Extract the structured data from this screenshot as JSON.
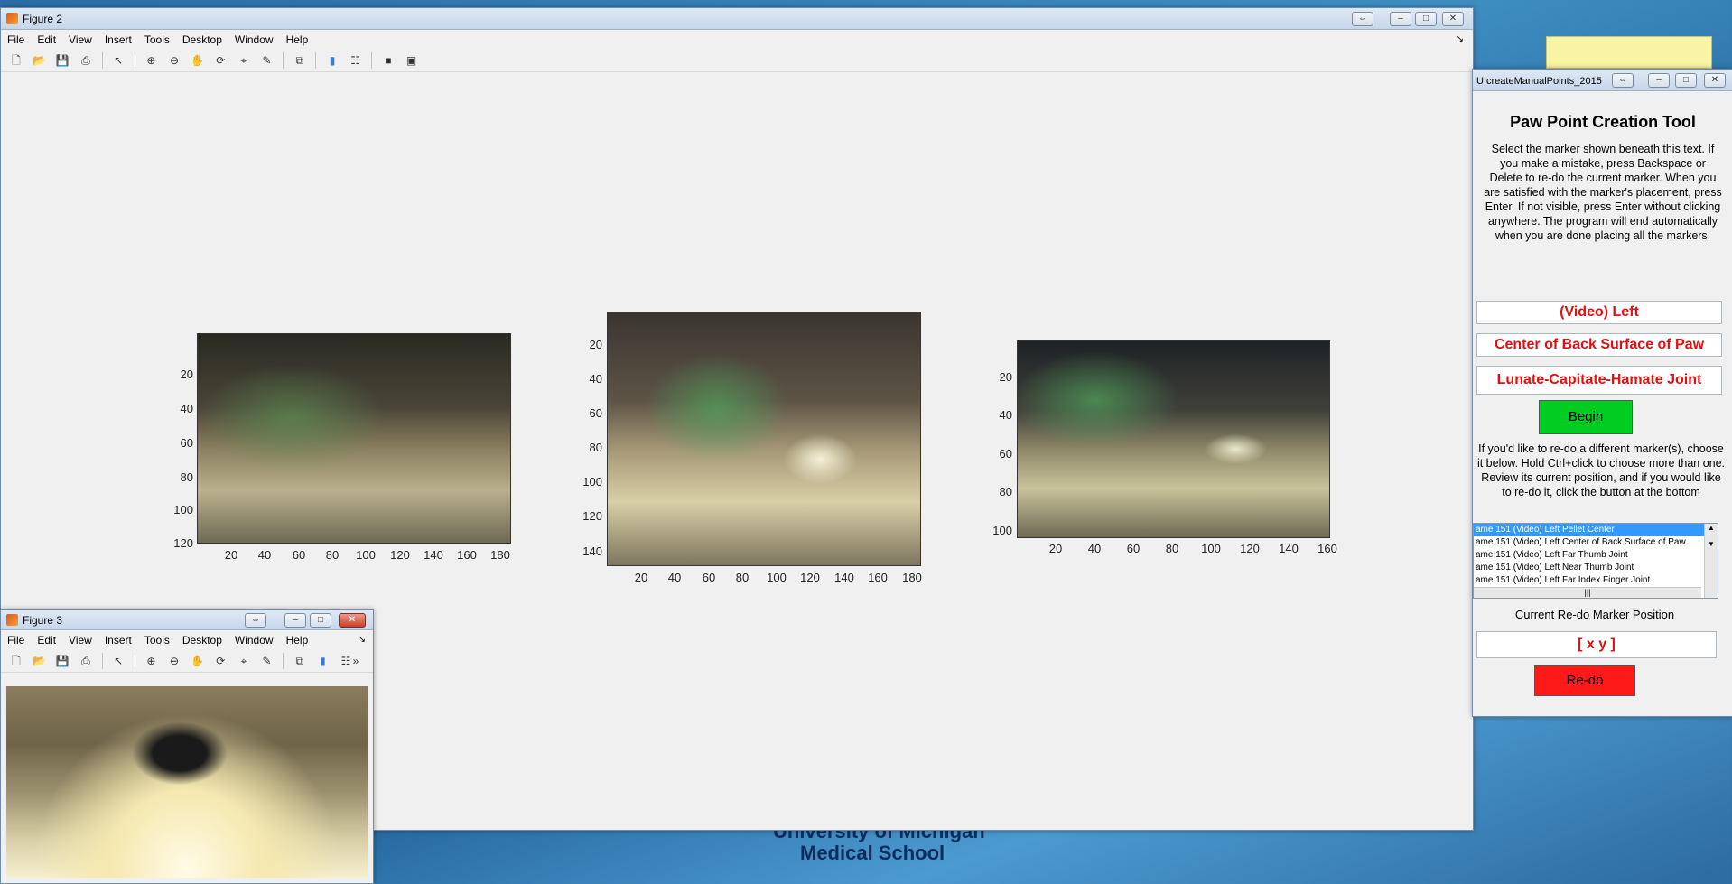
{
  "desktop": {
    "wallpaper_text_1": "University of Michigan",
    "wallpaper_text_2": "Medical School"
  },
  "figure2": {
    "title": "Figure 2",
    "menu": [
      "File",
      "Edit",
      "View",
      "Insert",
      "Tools",
      "Desktop",
      "Window",
      "Help"
    ],
    "axes": [
      {
        "yticks": [
          "20",
          "40",
          "60",
          "80",
          "100",
          "120"
        ],
        "xticks": [
          "20",
          "40",
          "60",
          "80",
          "100",
          "120",
          "140",
          "160",
          "180"
        ]
      },
      {
        "yticks": [
          "20",
          "40",
          "60",
          "80",
          "100",
          "120",
          "140"
        ],
        "xticks": [
          "20",
          "40",
          "60",
          "80",
          "100",
          "120",
          "140",
          "160",
          "180"
        ]
      },
      {
        "yticks": [
          "20",
          "40",
          "60",
          "80",
          "100"
        ],
        "xticks": [
          "20",
          "40",
          "60",
          "80",
          "100",
          "120",
          "140",
          "160"
        ]
      }
    ]
  },
  "figure3": {
    "title": "Figure 3",
    "menu": [
      "File",
      "Edit",
      "View",
      "Insert",
      "Tools",
      "Desktop",
      "Window",
      "Help"
    ]
  },
  "tool": {
    "window_title": "UIcreateManualPoints_2015",
    "heading": "Paw Point Creation Tool",
    "instructions": "Select the marker shown beneath this text. If you make a mistake, press Backspace or Delete to re-do the current marker. When you are satisfied with the marker's placement, press Enter. If not visible, press Enter without clicking anywhere. The program will end automatically when you are done placing all the markers.",
    "view_label": "(Video) Left",
    "marker_label": "Center of Back Surface of Paw",
    "joint_label": "Lunate-Capitate-Hamate Joint",
    "begin_label": "Begin",
    "redo_instructions": "If you'd like to re-do a different marker(s), choose it below. Hold Ctrl+click to choose more than one. Review its current position, and if you would like to re-do it, click the button at the bottom",
    "list_items": [
      "ame 151 (Video) Left Pellet Center",
      "ame 151 (Video) Left Center of Back Surface of Paw",
      "ame 151 (Video) Left Far Thumb Joint",
      "ame 151 (Video) Left Near Thumb Joint",
      "ame 151 (Video) Left Far Index Finger Joint"
    ],
    "redo_position_label": "Current Re-do Marker Position",
    "position_value": "[ x y ]",
    "redo_label": "Re-do"
  },
  "colors": {
    "begin_green": "#00cc22",
    "redo_red": "#ff1a1a",
    "label_red": "#e01010"
  }
}
